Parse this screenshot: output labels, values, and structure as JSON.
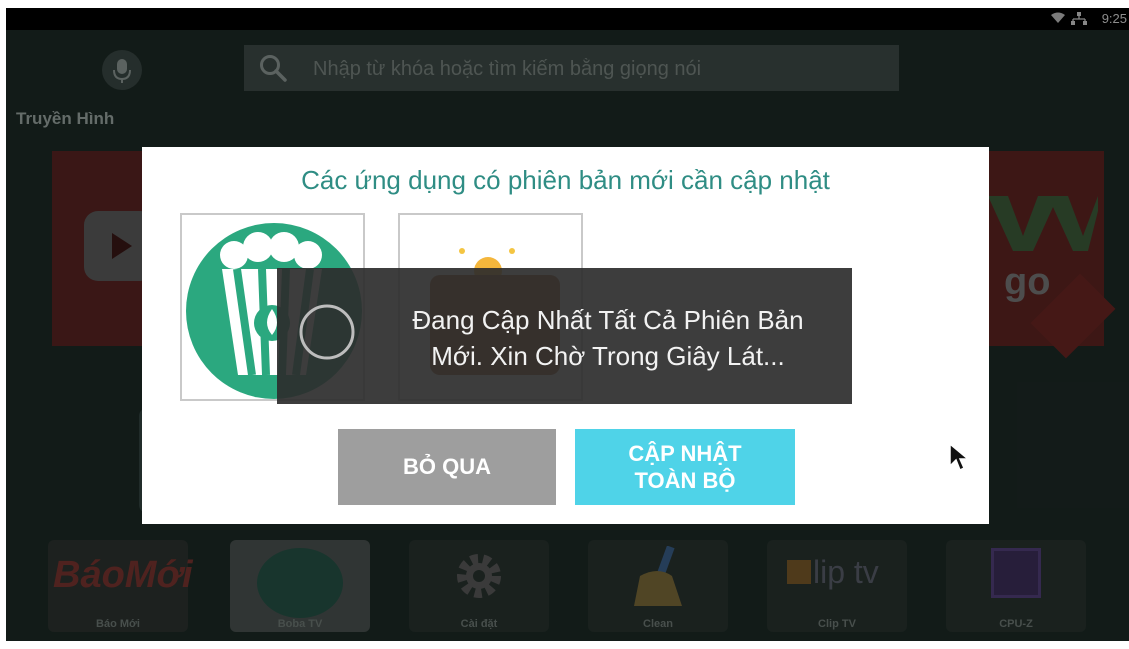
{
  "status_bar": {
    "time": "9:25",
    "icons": [
      "wifi-icon",
      "ethernet-icon"
    ]
  },
  "search": {
    "placeholder": "Nhập từ khóa hoặc tìm kiếm bằng giọng nói",
    "icons": [
      "mic-icon",
      "search-icon"
    ]
  },
  "section": {
    "title": "Truyền Hình"
  },
  "apps": [
    {
      "label": "Báo Mới",
      "icon": "baomoi-icon"
    },
    {
      "label": "Boba TV",
      "icon": "boba-tv-icon"
    },
    {
      "label": "Cài đặt",
      "icon": "settings-gear-icon"
    },
    {
      "label": "Clean",
      "icon": "broom-icon"
    },
    {
      "label": "Clip TV",
      "icon": "cliptv-icon"
    },
    {
      "label": "CPU-Z",
      "icon": "cpu-chip-icon"
    }
  ],
  "app_logos": {
    "baomoi": "BáoMới",
    "cliptv": "lip tv",
    "vtv": "go"
  },
  "dialog": {
    "title": "Các ứng dụng có phiên bản mới cần cập nhật",
    "skip_label": "BỎ QUA",
    "update_line1": "CẬP NHẬT",
    "update_line2": "TOÀN BỘ"
  },
  "progress": {
    "line1": "Đang Cập Nhất Tất Cả Phiên Bản",
    "line2": "Mới. Xin Chờ Trong Giây Lát..."
  },
  "colors": {
    "accent": "#4fd3e8",
    "title": "#2f8d84",
    "skip": "#9e9e9e"
  }
}
